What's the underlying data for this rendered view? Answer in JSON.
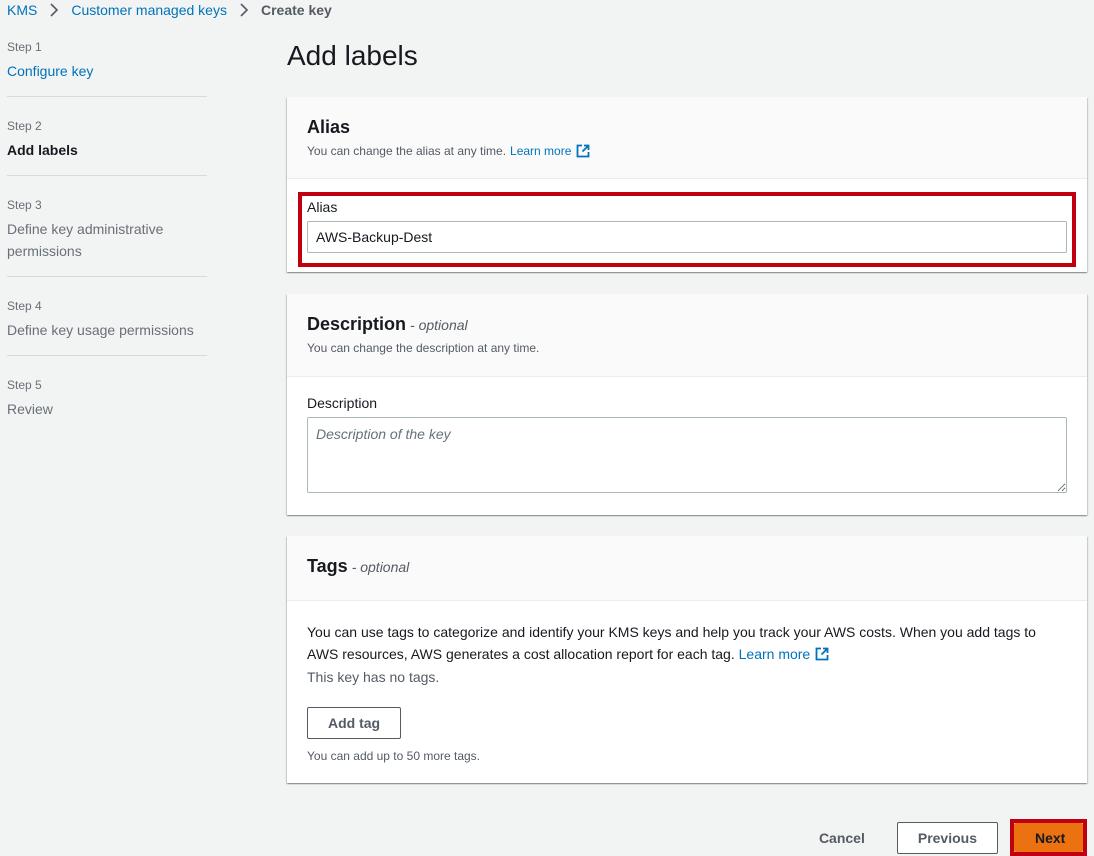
{
  "breadcrumb": {
    "items": [
      "KMS",
      "Customer managed keys"
    ],
    "current": "Create key"
  },
  "steps": [
    {
      "num": "Step 1",
      "title": "Configure key",
      "state": "link"
    },
    {
      "num": "Step 2",
      "title": "Add labels",
      "state": "active"
    },
    {
      "num": "Step 3",
      "title": "Define key administrative permissions",
      "state": "muted"
    },
    {
      "num": "Step 4",
      "title": "Define key usage permissions",
      "state": "muted"
    },
    {
      "num": "Step 5",
      "title": "Review",
      "state": "muted"
    }
  ],
  "page_title": "Add labels",
  "alias_panel": {
    "title": "Alias",
    "description": "You can change the alias at any time.",
    "learn_more": "Learn more",
    "field_label": "Alias",
    "value": "AWS-Backup-Dest"
  },
  "description_panel": {
    "title": "Description",
    "optional": "- optional",
    "description": "You can change the description at any time.",
    "field_label": "Description",
    "placeholder": "Description of the key"
  },
  "tags_panel": {
    "title": "Tags",
    "optional": "- optional",
    "body_text": "You can use tags to categorize and identify your KMS keys and help you track your AWS costs. When you add tags to AWS resources, AWS generates a cost allocation report for each tag.",
    "learn_more": "Learn more",
    "no_tags": "This key has no tags.",
    "add_tag": "Add tag",
    "hint": "You can add up to 50 more tags."
  },
  "footer": {
    "cancel": "Cancel",
    "previous": "Previous",
    "next": "Next"
  },
  "colors": {
    "link": "#0073bb",
    "primary": "#ec7211",
    "highlight": "#c0000f",
    "background": "#f2f3f3"
  }
}
